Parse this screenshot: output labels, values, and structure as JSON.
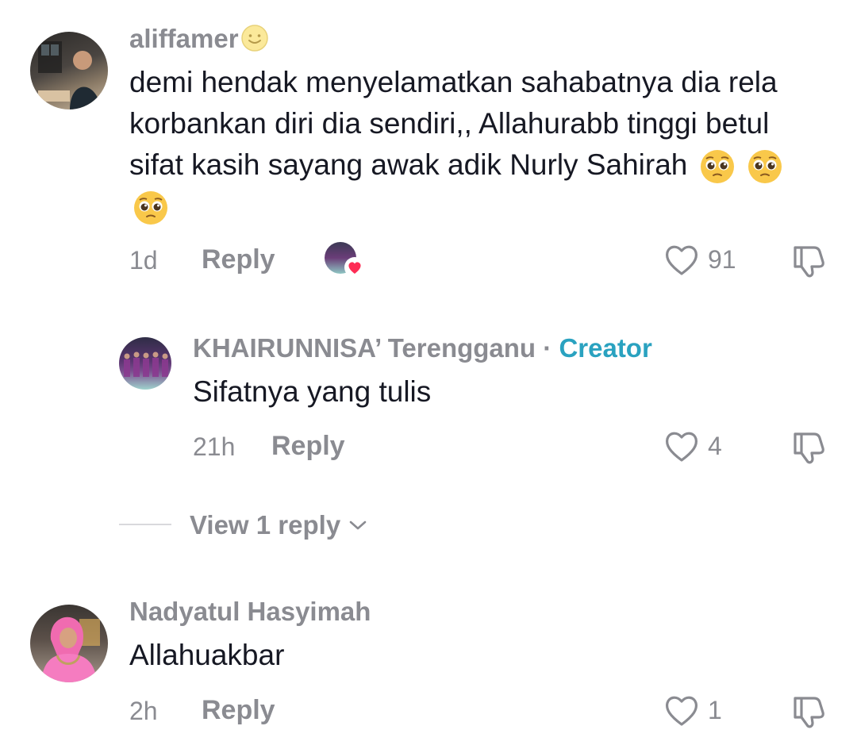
{
  "comments": [
    {
      "username": "aliffamer",
      "text": "demi hendak menyelamatkan sahabatnya dia rela korbankan diri dia sendiri,, Allahurabb tinggi betul sifat kasih sayang awak adik Nurly Sahirah",
      "time": "1d",
      "reply_label": "Reply",
      "likes": "91",
      "liked_by_creator": true
    },
    {
      "username": "KHAIRUNNISA’ Terengganu",
      "separator": "·",
      "badge": "Creator",
      "text": "Sifatnya yang tulis",
      "time": "21h",
      "reply_label": "Reply",
      "likes": "4"
    },
    {
      "view_replies_label": "View 1 reply"
    },
    {
      "username": "Nadyatul Hasyimah",
      "text": "Allahuakbar",
      "time": "2h",
      "reply_label": "Reply",
      "likes": "1"
    }
  ],
  "colors": {
    "text": "#161823",
    "muted": "#8a8b91",
    "creator_badge": "#2aa2c0",
    "heart_badge": "#fe2c55"
  }
}
